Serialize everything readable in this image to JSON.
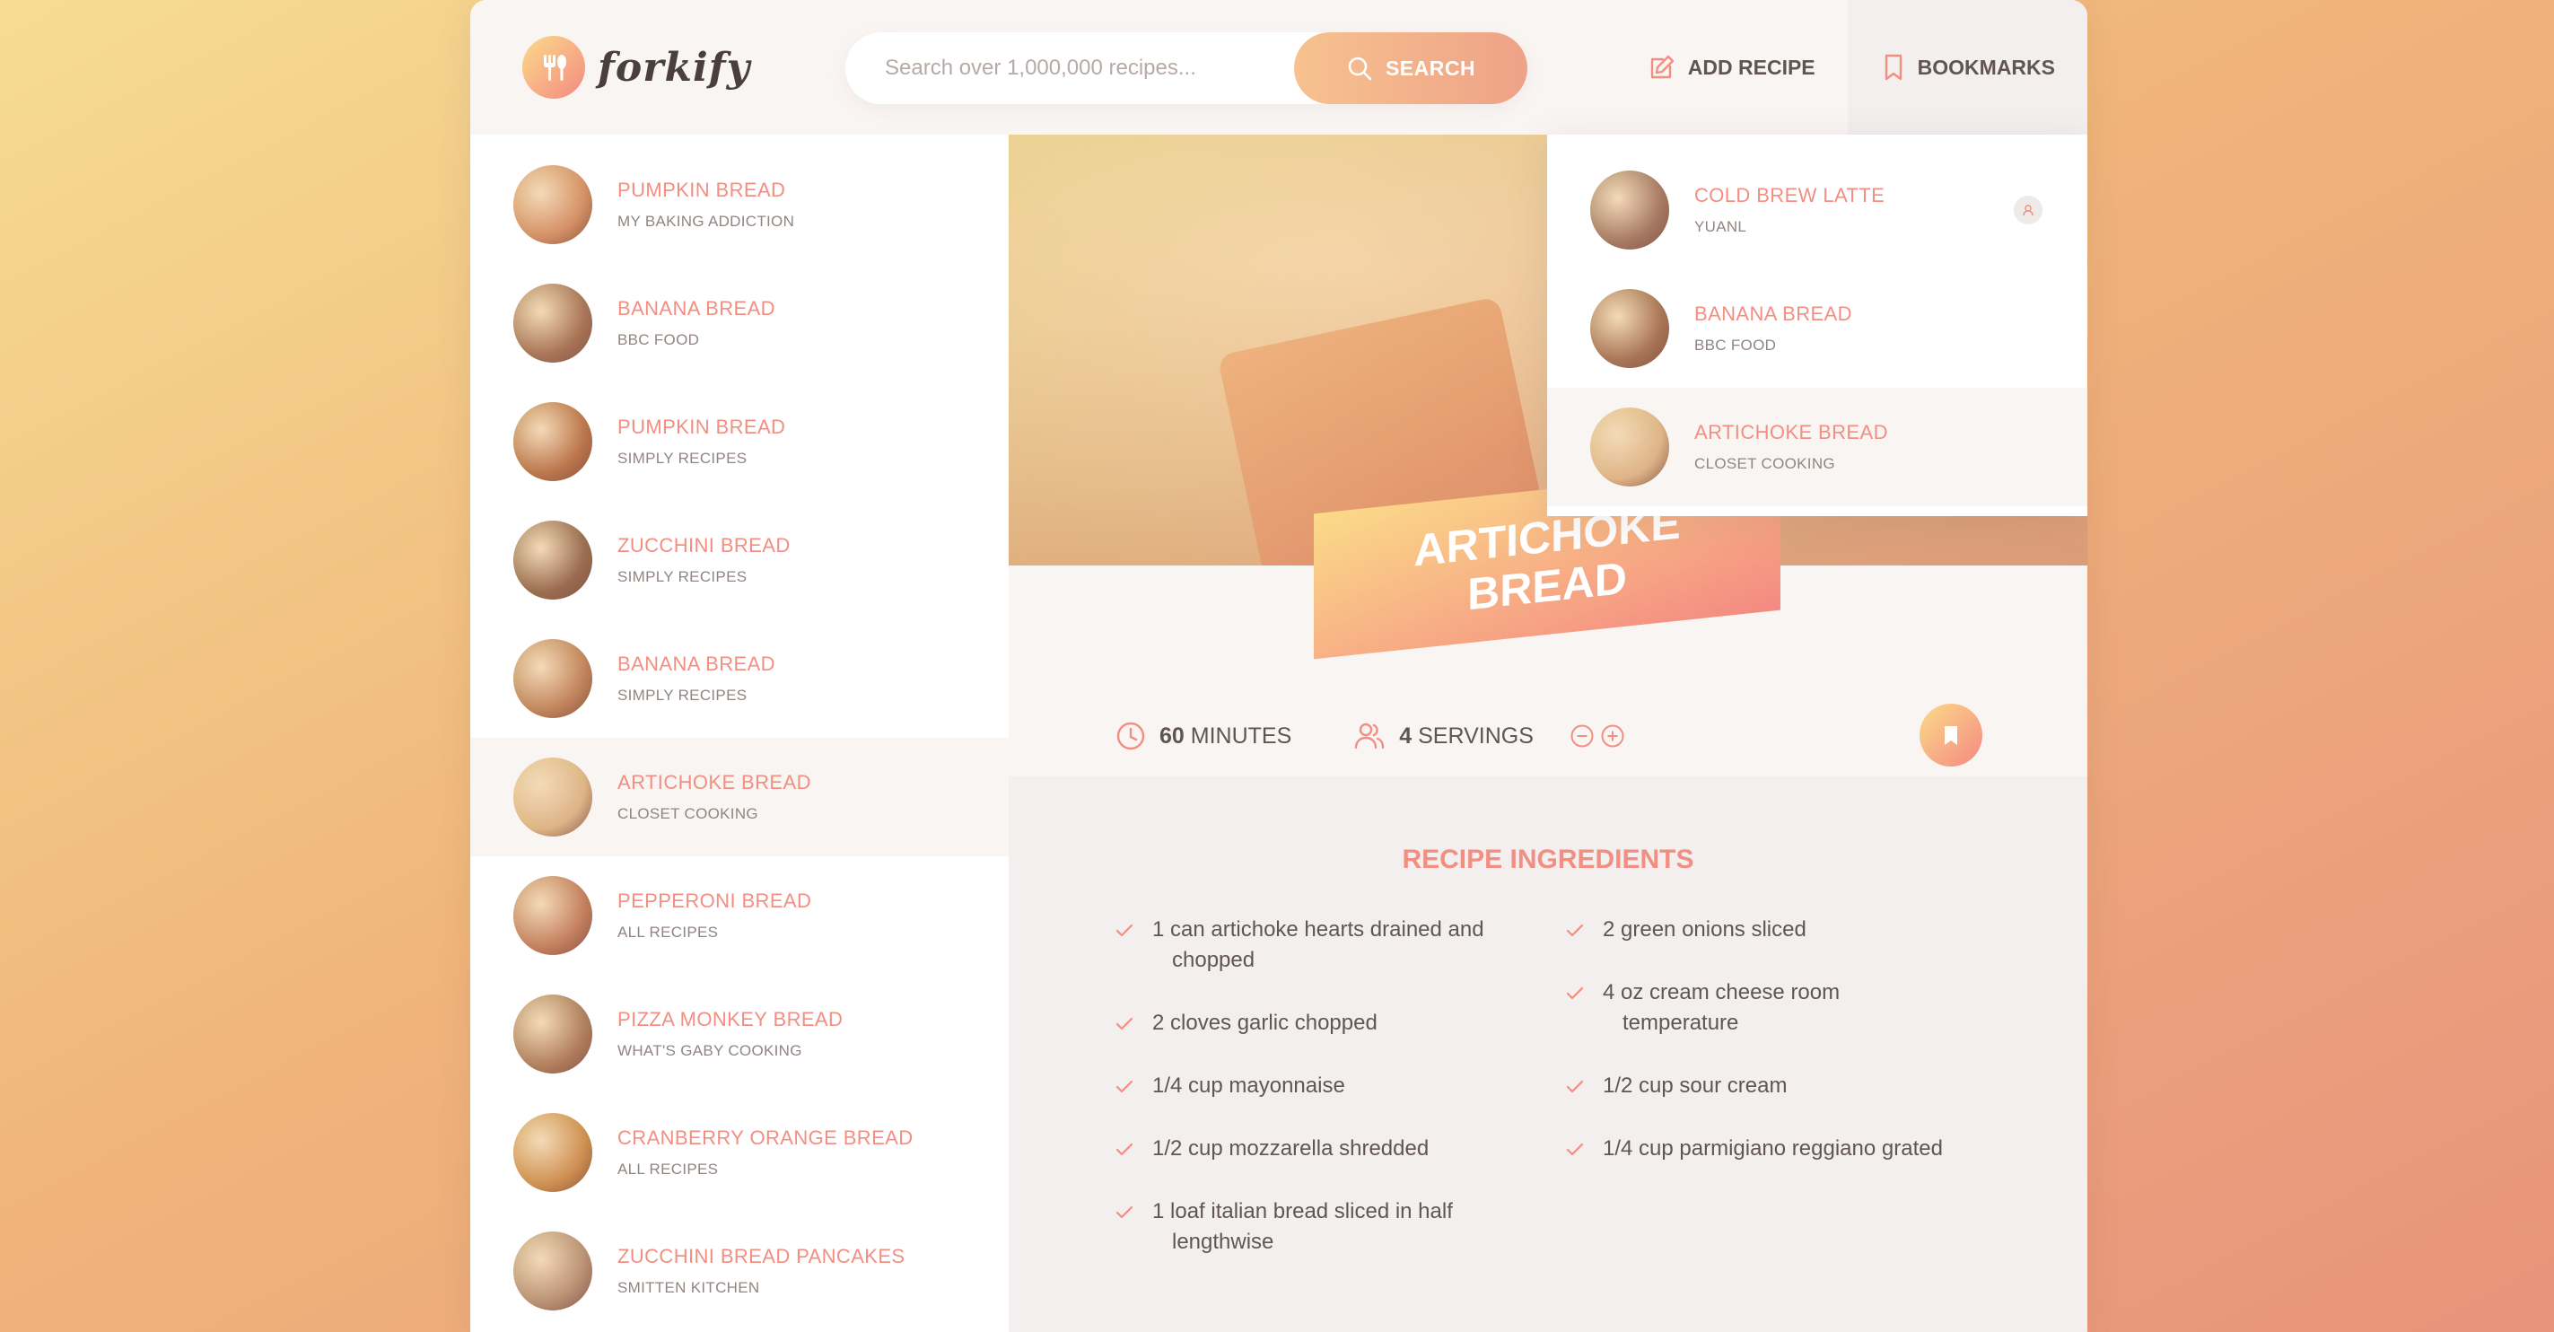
{
  "app": {
    "logo_text": "forkify"
  },
  "search": {
    "placeholder": "Search over 1,000,000 recipes...",
    "button_label": "SEARCH"
  },
  "nav": {
    "add_recipe": "ADD RECIPE",
    "bookmarks": "BOOKMARKS"
  },
  "results": [
    {
      "title": "Pumpkin Bread",
      "publisher": "My Baking Addiction",
      "thumb": "#c98a5a"
    },
    {
      "title": "Banana Bread",
      "publisher": "BBC Food",
      "thumb": "#8f6547"
    },
    {
      "title": "Pumpkin Bread",
      "publisher": "Simply Recipes",
      "thumb": "#a86638"
    },
    {
      "title": "Zucchini Bread",
      "publisher": "Simply Recipes",
      "thumb": "#7c5a3f"
    },
    {
      "title": "Banana Bread",
      "publisher": "Simply Recipes",
      "thumb": "#b07a4e"
    },
    {
      "title": "Artichoke Bread",
      "publisher": "Closet Cooking",
      "thumb": "#d6b987"
    },
    {
      "title": "Pepperoni Bread",
      "publisher": "All Recipes",
      "thumb": "#b37352"
    },
    {
      "title": "Pizza Monkey Bread",
      "publisher": "What's Gaby Cooking",
      "thumb": "#9a7350"
    },
    {
      "title": "Cranberry Orange Bread",
      "publisher": "All Recipes",
      "thumb": "#c28a40"
    },
    {
      "title": "Zucchini Bread Pancakes",
      "publisher": "Smitten Kitchen",
      "thumb": "#a58a6e"
    }
  ],
  "bookmarks": [
    {
      "title": "Cold Brew Latte",
      "publisher": "yuanl",
      "thumb": "#8c6b57",
      "user_generated": true
    },
    {
      "title": "Banana Bread",
      "publisher": "BBC Food",
      "thumb": "#8f6547",
      "user_generated": false
    },
    {
      "title": "Artichoke Bread",
      "publisher": "Closet Cooking",
      "thumb": "#d6b987",
      "user_generated": false
    }
  ],
  "recipe": {
    "title": "Artichoke Bread",
    "minutes": "60",
    "minutes_label": "MINUTES",
    "servings": "4",
    "servings_label": "SERVINGS",
    "ingredients_heading": "RECIPE INGREDIENTS",
    "ingredients_left": [
      "1 can artichoke hearts drained and chopped",
      "2 cloves garlic chopped",
      "1/4 cup mayonnaise",
      "1/2 cup mozzarella shredded",
      "1 loaf italian bread sliced in half lengthwise"
    ],
    "ingredients_right": [
      "2 green onions sliced",
      "4 oz cream cheese room temperature",
      "1/2 cup sour cream",
      "1/4 cup parmigiano reggiano grated"
    ]
  },
  "colors": {
    "accent": "#f38e82",
    "gradient_start": "#fbdb89",
    "gradient_end": "#f48982"
  }
}
